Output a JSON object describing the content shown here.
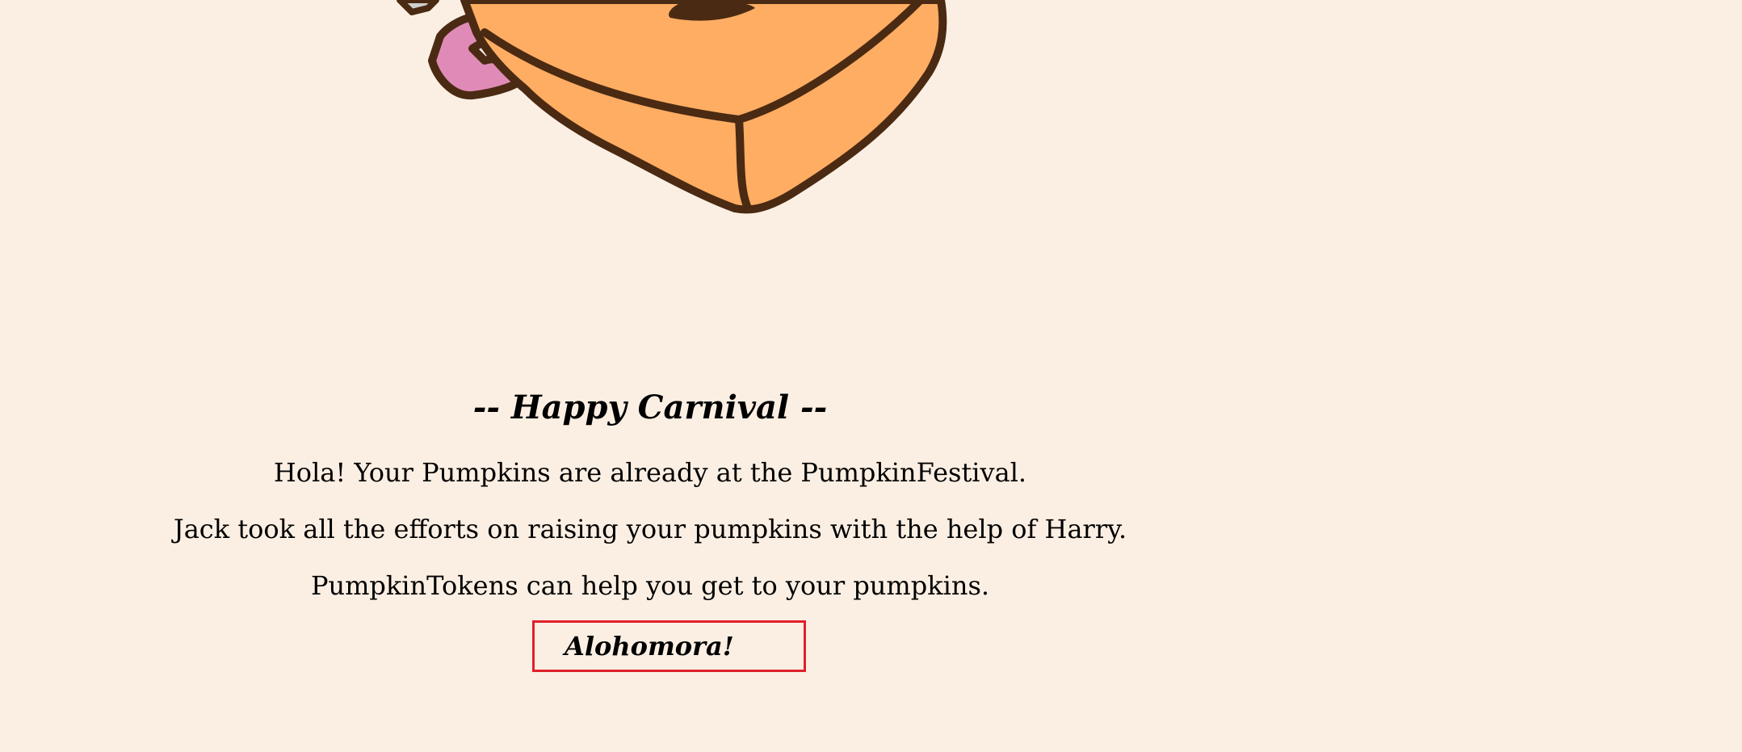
{
  "header": {
    "title": "-- Happy Carnival --"
  },
  "main": {
    "lines": [
      "Hola! Your Pumpkins are already at the PumpkinFestival.",
      "Jack took all the efforts on raising your pumpkins with the help of Harry.",
      "PumpkinTokens can help you get to your pumpkins."
    ],
    "cta_label": "Alohomora!"
  },
  "colors": {
    "background": "#fbefe3",
    "box_fill": "#ffad63",
    "outline": "#4a2a12",
    "pink_accent": "#e08bb7",
    "button_border": "#e0202a"
  },
  "icons": {
    "illustration": "cartoon-pumpkin-box-character"
  }
}
